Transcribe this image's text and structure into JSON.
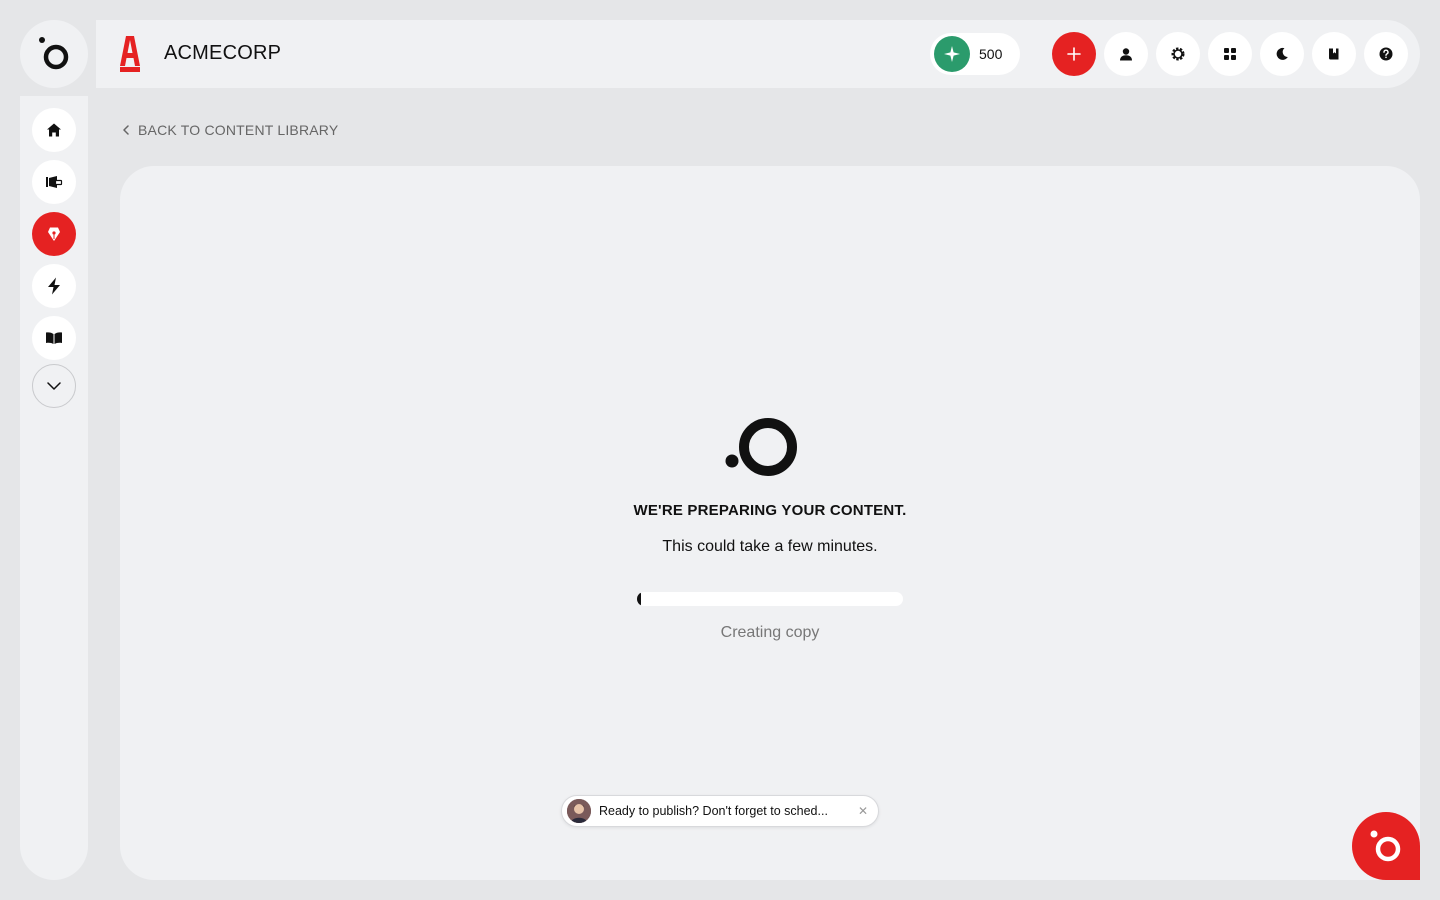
{
  "brand": {
    "name": "ACMECORP"
  },
  "credits": {
    "value": "500"
  },
  "topbar": {
    "buttons": [
      "add-icon",
      "user-icon",
      "settings-icon",
      "grid-icon",
      "moon-icon",
      "book-icon",
      "help-icon"
    ]
  },
  "sidebar": {
    "items": [
      "home-icon",
      "megaphone-icon",
      "pen-nib-icon",
      "lightning-icon",
      "open-book-icon",
      "chevron-down-icon"
    ],
    "active_index": 2
  },
  "nav": {
    "back_label": "BACK TO CONTENT LIBRARY"
  },
  "loading": {
    "title": "WE'RE PREPARING YOUR CONTENT.",
    "subtitle": "This could take a few minutes.",
    "progress": 0.01,
    "status": "Creating copy"
  },
  "toast": {
    "message": "Ready to publish? Don't forget to sched..."
  },
  "colors": {
    "accent": "#e52222",
    "credit": "#2b9b6c",
    "panel": "#f0f1f3",
    "background": "#e5e6e8"
  }
}
